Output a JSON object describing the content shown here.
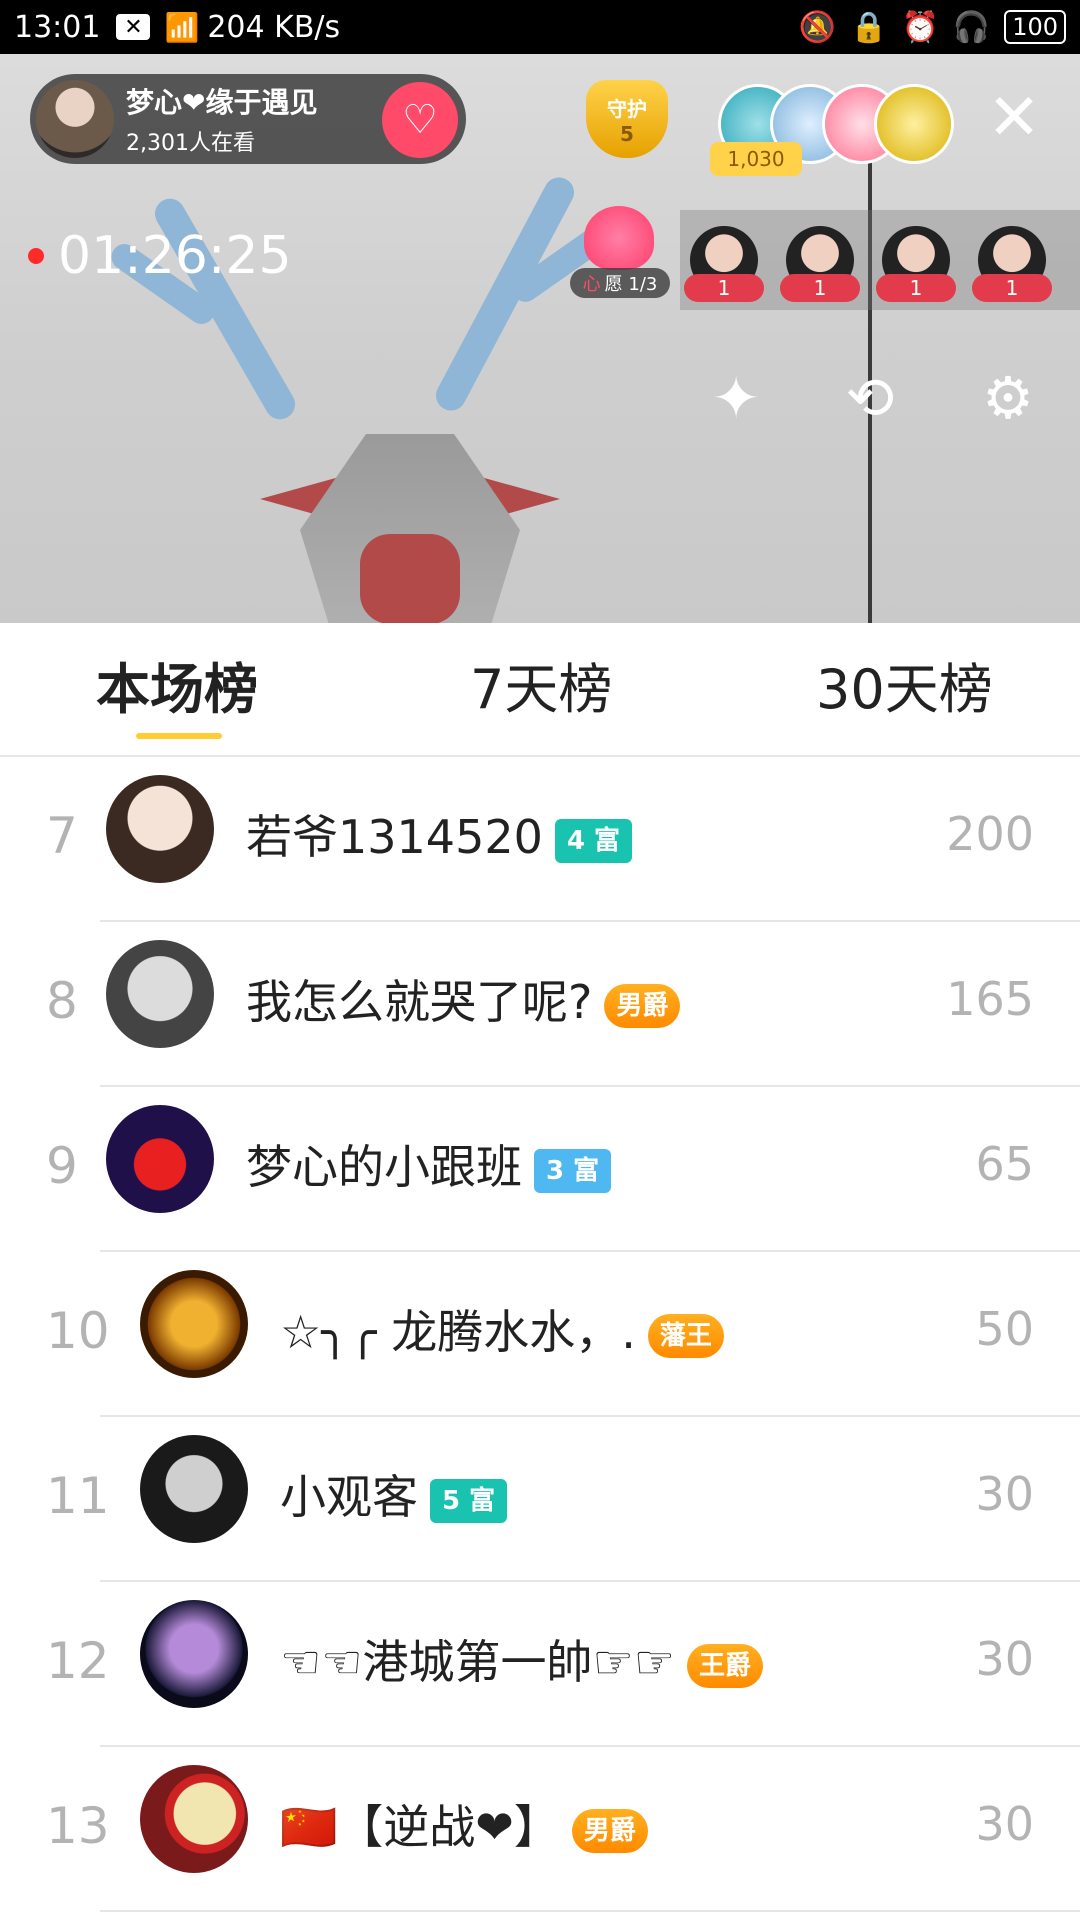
{
  "status_bar": {
    "time": "13:01",
    "x_icon": "✕",
    "wifi_icon": "wifi-icon",
    "speed": "204 KB/s",
    "icons": [
      "bell-off-icon",
      "lock-icon",
      "alarm-icon",
      "headphones-icon"
    ],
    "battery": "100"
  },
  "live": {
    "host_name": "梦心❤缘于遇见",
    "viewers": "2,301人在看",
    "guard": {
      "label": "守护",
      "count": "5"
    },
    "score": "1,030",
    "timer": "01:26:25",
    "wish": {
      "label_red": "心",
      "label": "愿 1/3"
    },
    "gift_senders": [
      {
        "count": "1"
      },
      {
        "count": "1"
      },
      {
        "count": "1"
      },
      {
        "count": "1"
      }
    ]
  },
  "tabs": [
    {
      "label": "本场榜"
    },
    {
      "label": "7天榜"
    },
    {
      "label": "30天榜"
    }
  ],
  "leaderboard": [
    {
      "rank": "7",
      "name": "若爷1314520",
      "badge": "4 富",
      "badge_style": "teal",
      "score": "200"
    },
    {
      "rank": "8",
      "name": "我怎么就哭了呢?",
      "badge": "男爵",
      "badge_style": "gold",
      "score": "165"
    },
    {
      "rank": "9",
      "name": "梦心的小跟班",
      "badge": "3 富",
      "badge_style": "blue",
      "score": "65"
    },
    {
      "rank": "10",
      "name": "☆╮╭ 龙腾水水，.",
      "badge": "藩王",
      "badge_style": "gold",
      "score": "50"
    },
    {
      "rank": "11",
      "name": "小观客",
      "badge": "5 富",
      "badge_style": "teal",
      "score": "30"
    },
    {
      "rank": "12",
      "name": "☜☜港城第一帥☞☞",
      "badge": "王爵",
      "badge_style": "gold",
      "score": "30"
    },
    {
      "rank": "13",
      "name": "🇨🇳【逆战❤】",
      "badge": "男爵",
      "badge_style": "gold",
      "score": "30"
    }
  ]
}
